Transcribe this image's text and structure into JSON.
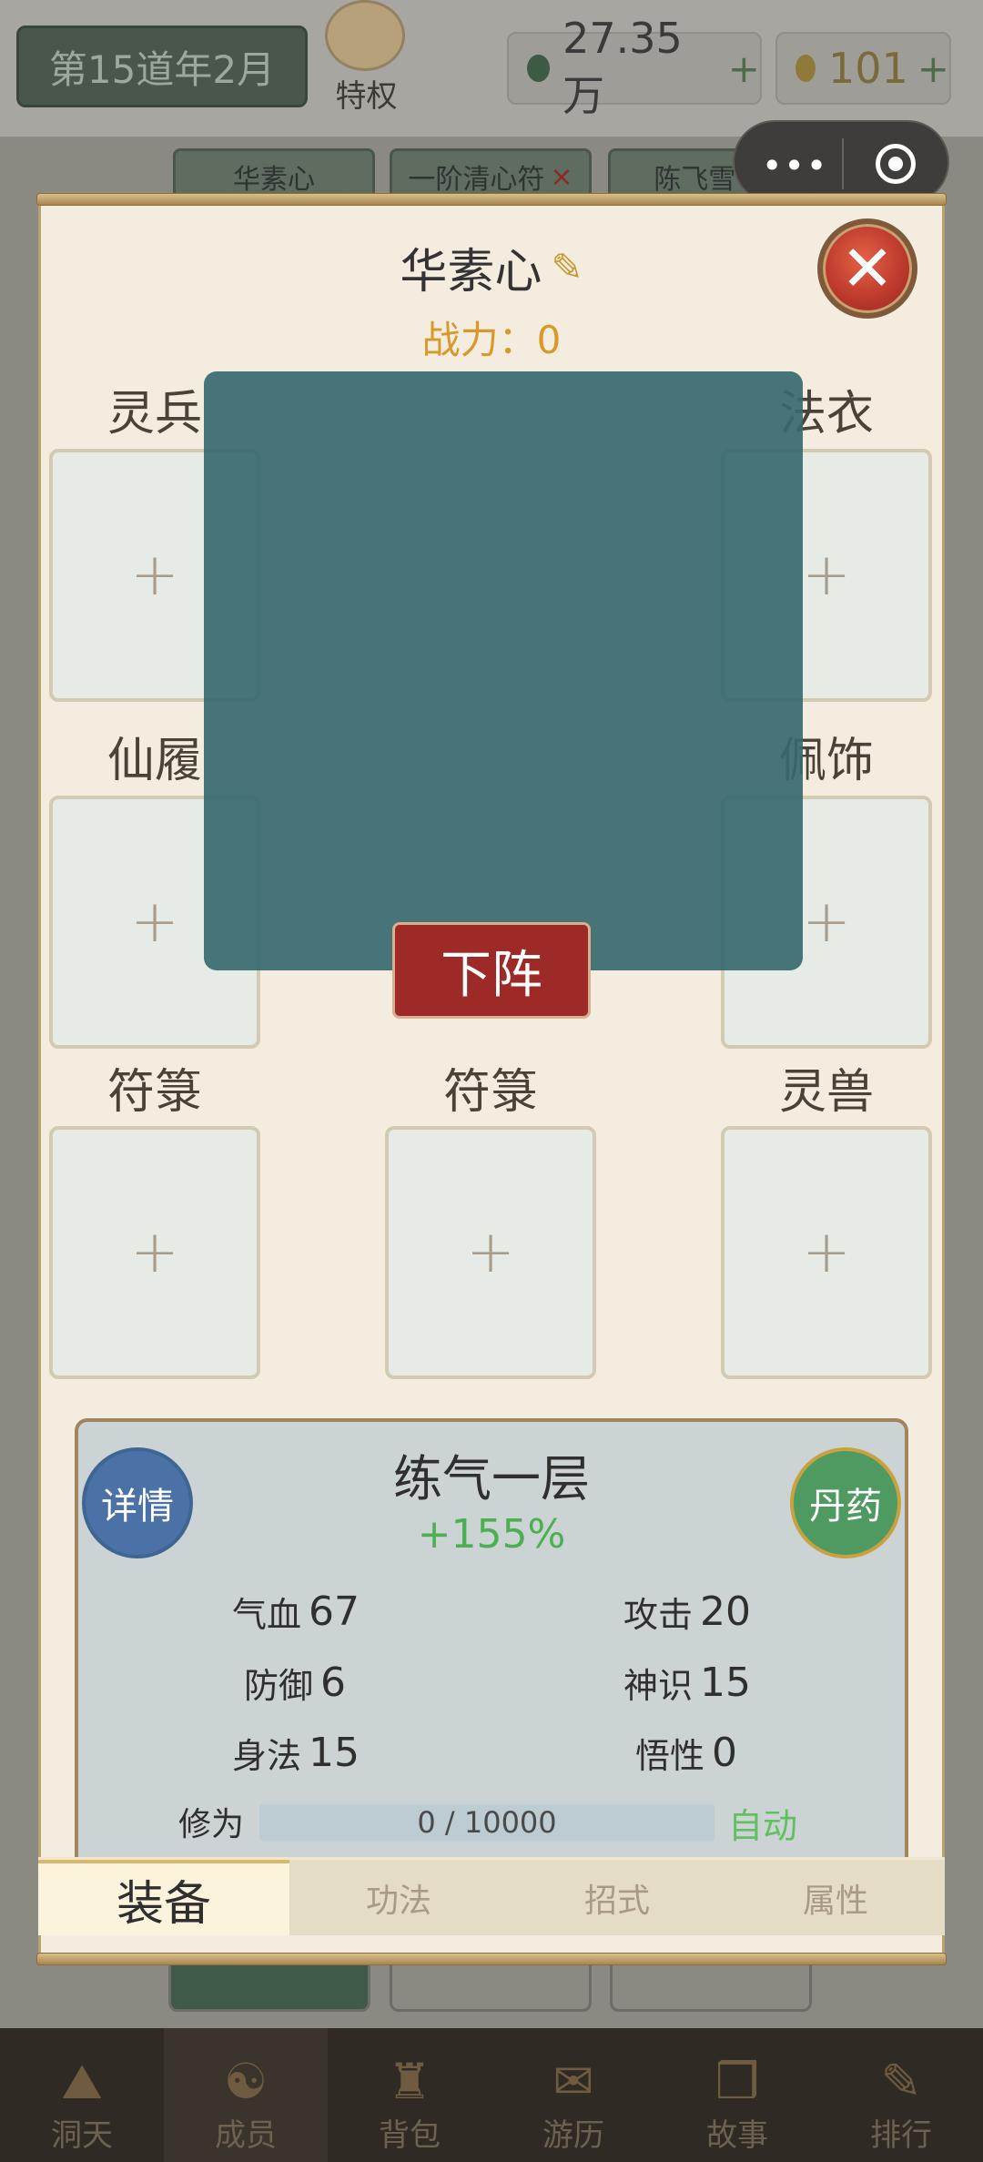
{
  "header": {
    "date": "第15道年2月",
    "privilege_label": "特权",
    "currency_1": "27.35万",
    "currency_2": "101",
    "plus": "+"
  },
  "bg_tabs": [
    {
      "label": "华素心"
    },
    {
      "label": "一阶清心符",
      "close": "×"
    },
    {
      "label": "陈飞雪",
      "close": "×"
    }
  ],
  "modal": {
    "name": "华素心",
    "power": "战力：0",
    "slots": {
      "weapon": "灵兵",
      "robe": "法衣",
      "boots": "仙履",
      "accessory": "佩饰",
      "talisman_1": "符箓",
      "talisman_2": "符箓",
      "beast": "灵兽"
    },
    "slot_plus": "+",
    "unassign_button": "下阵",
    "stats": {
      "realm": "练气一层",
      "bonus": "+155%",
      "detail_button": "详情",
      "pill_button": "丹药",
      "hp_label": "气血",
      "hp": "67",
      "atk_label": "攻击",
      "atk": "20",
      "def_label": "防御",
      "def": "6",
      "spirit_label": "神识",
      "spirit": "15",
      "agility_label": "身法",
      "agility": "15",
      "insight_label": "悟性",
      "insight": "0",
      "cultivation_label": "修为",
      "cultivation": "0 / 10000",
      "cultivation_progress": 0,
      "auto": "自动"
    },
    "tabs": [
      "装备",
      "功法",
      "招式",
      "属性"
    ],
    "active_tab": "装备"
  },
  "bottom_nav": [
    "洞天",
    "成员",
    "背包",
    "游历",
    "故事",
    "排行"
  ],
  "active_nav": "成员",
  "colors": {
    "close_red": "#b9362a",
    "unassign_red": "#9d2a27",
    "power_gold": "#d79a2a",
    "bonus_green": "#4caf50",
    "detail_blue": "#4a72a6",
    "pill_green": "#4e9a60"
  }
}
